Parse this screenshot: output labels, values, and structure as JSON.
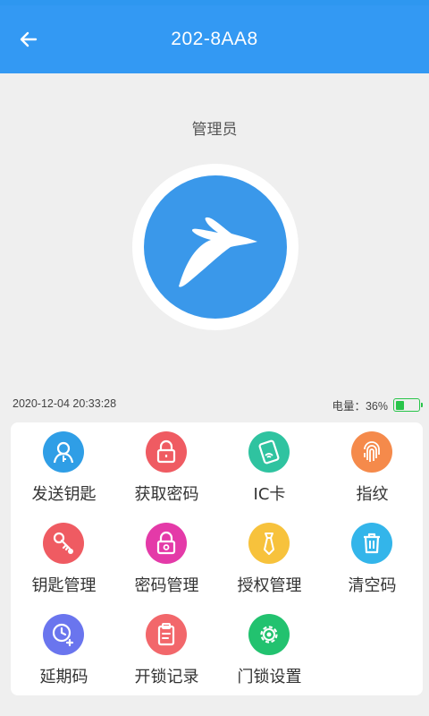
{
  "header": {
    "title": "202-8AA8"
  },
  "role_label": "管理员",
  "device": {
    "datetime": "2020-12-04 20:33:28",
    "battery_label": "电量：36%",
    "battery_level": 0.36
  },
  "colors": {
    "header": "#3399f3",
    "avatar": "#3a98ea",
    "battery": "#29c44a"
  },
  "menu": [
    {
      "label": "发送钥匙",
      "icon": "key-user-icon",
      "color": "#2f9ee6"
    },
    {
      "label": "获取密码",
      "icon": "lock-icon",
      "color": "#ef5b62"
    },
    {
      "label": "IC卡",
      "icon": "ic-card-icon",
      "color": "#2fc3a0"
    },
    {
      "label": "指纹",
      "icon": "fingerprint-icon",
      "color": "#f58a4b"
    },
    {
      "label": "钥匙管理",
      "icon": "key-gear-icon",
      "color": "#ef5b62"
    },
    {
      "label": "密码管理",
      "icon": "lock-gear-icon",
      "color": "#e43aa8"
    },
    {
      "label": "授权管理",
      "icon": "tie-icon",
      "color": "#f7c23c"
    },
    {
      "label": "清空码",
      "icon": "trash-icon",
      "color": "#33b5ea"
    },
    {
      "label": "延期码",
      "icon": "clock-plus-icon",
      "color": "#6a75ee"
    },
    {
      "label": "开锁记录",
      "icon": "clipboard-icon",
      "color": "#f2676b"
    },
    {
      "label": "门锁设置",
      "icon": "gear-icon",
      "color": "#22c26f"
    }
  ]
}
